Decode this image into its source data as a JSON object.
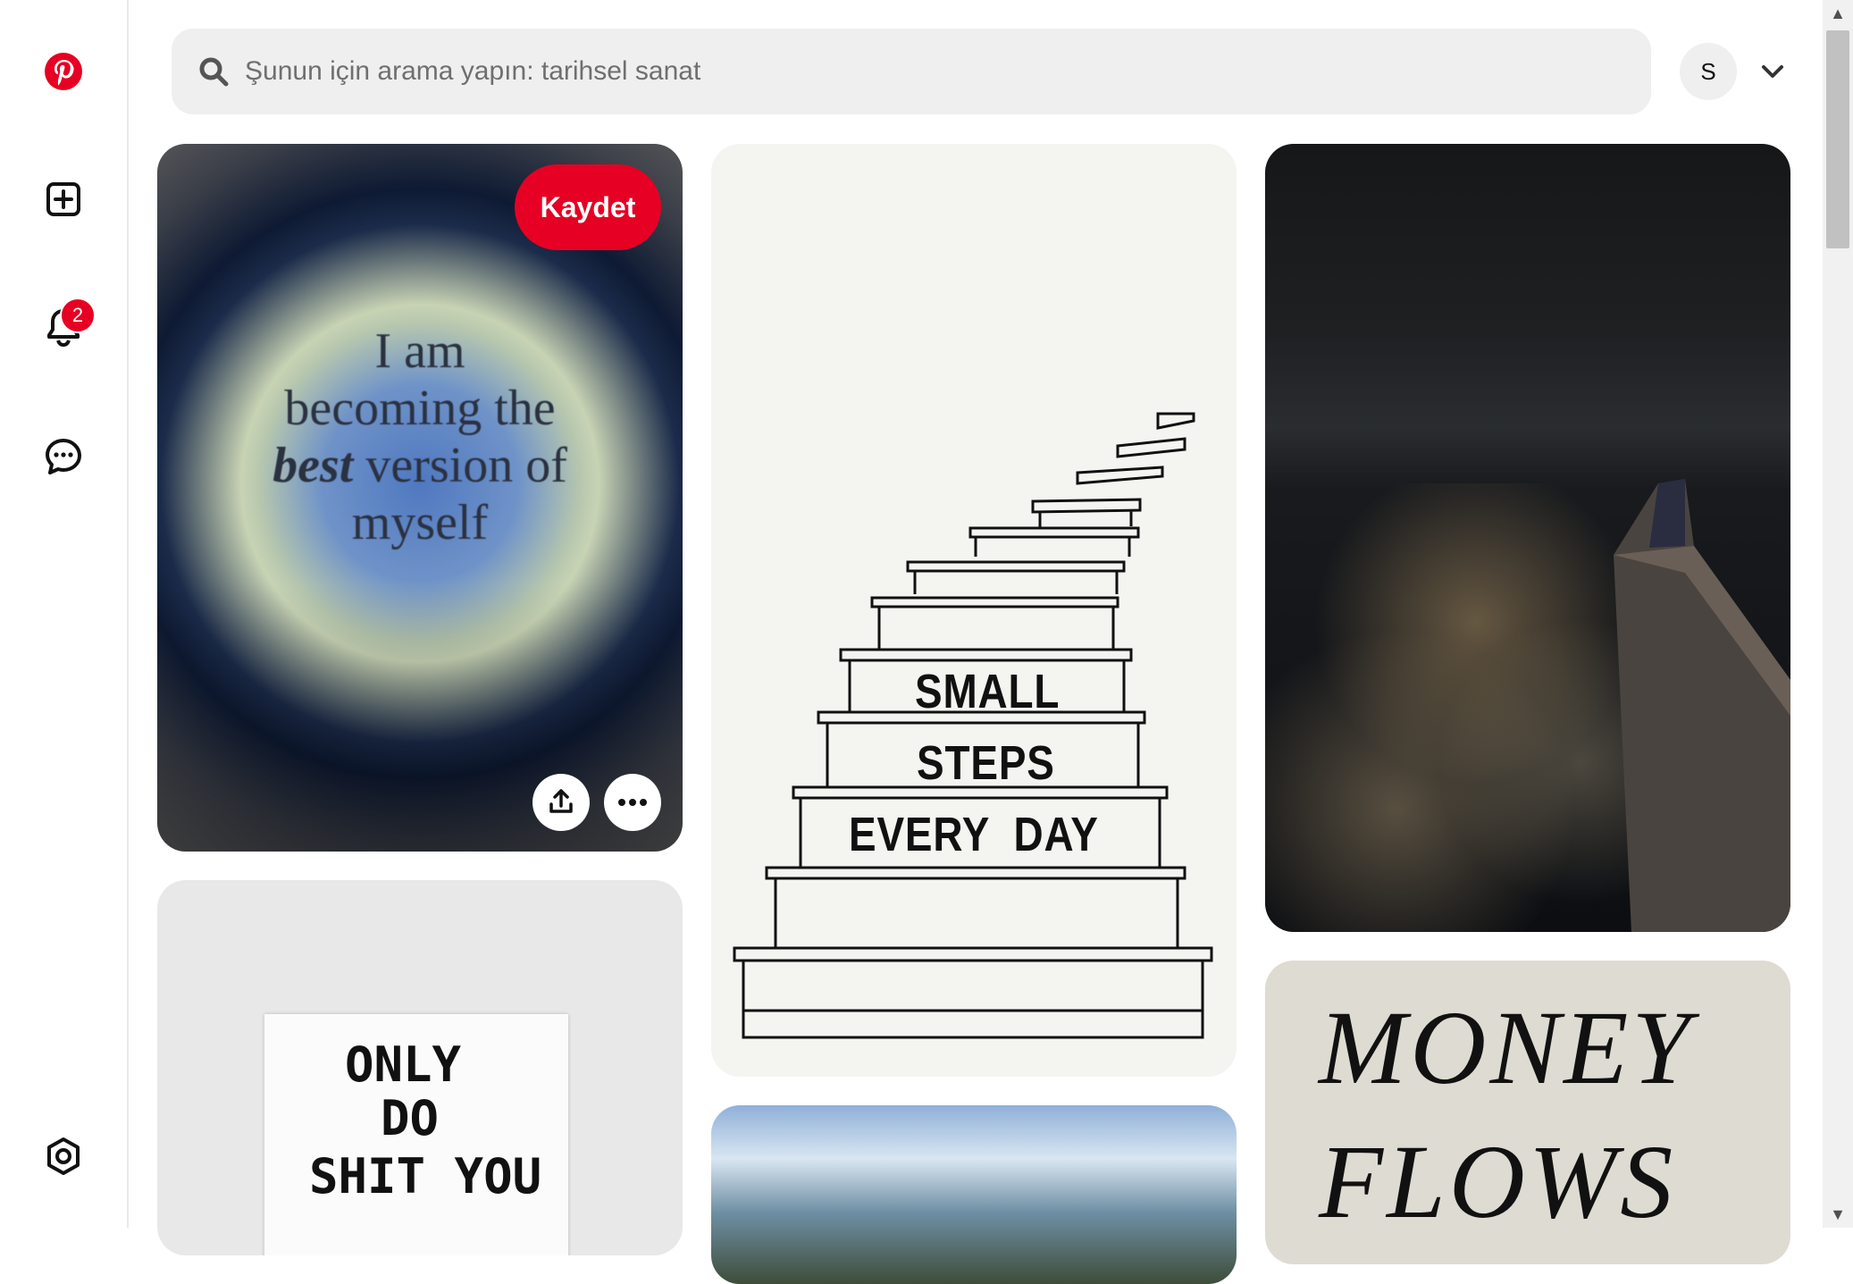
{
  "sidebar": {
    "items": [
      {
        "name": "pinterest-logo"
      },
      {
        "name": "create"
      },
      {
        "name": "notifications",
        "badge": "2"
      },
      {
        "name": "messages"
      },
      {
        "name": "settings"
      }
    ],
    "brand_color": "#e60023"
  },
  "header": {
    "search_placeholder": "Şunun için arama yapın: tarihsel sanat",
    "avatar_initial": "S"
  },
  "pins": {
    "pin1": {
      "save_label": "Kaydet",
      "quote_line1": "I am",
      "quote_line2": "becoming the",
      "quote_em": "best",
      "quote_line3_rest": " version of",
      "quote_line4": "myself"
    },
    "pin2": {
      "line1": "SMALL",
      "line2": "STEPS",
      "line3": "EVERY  DAY"
    },
    "pin4": {
      "line1": "ONLY",
      "line2": "DO",
      "line3": "SHIT YOU"
    },
    "pin6": {
      "line1": "MONEY",
      "line2": "FLOWS"
    }
  }
}
